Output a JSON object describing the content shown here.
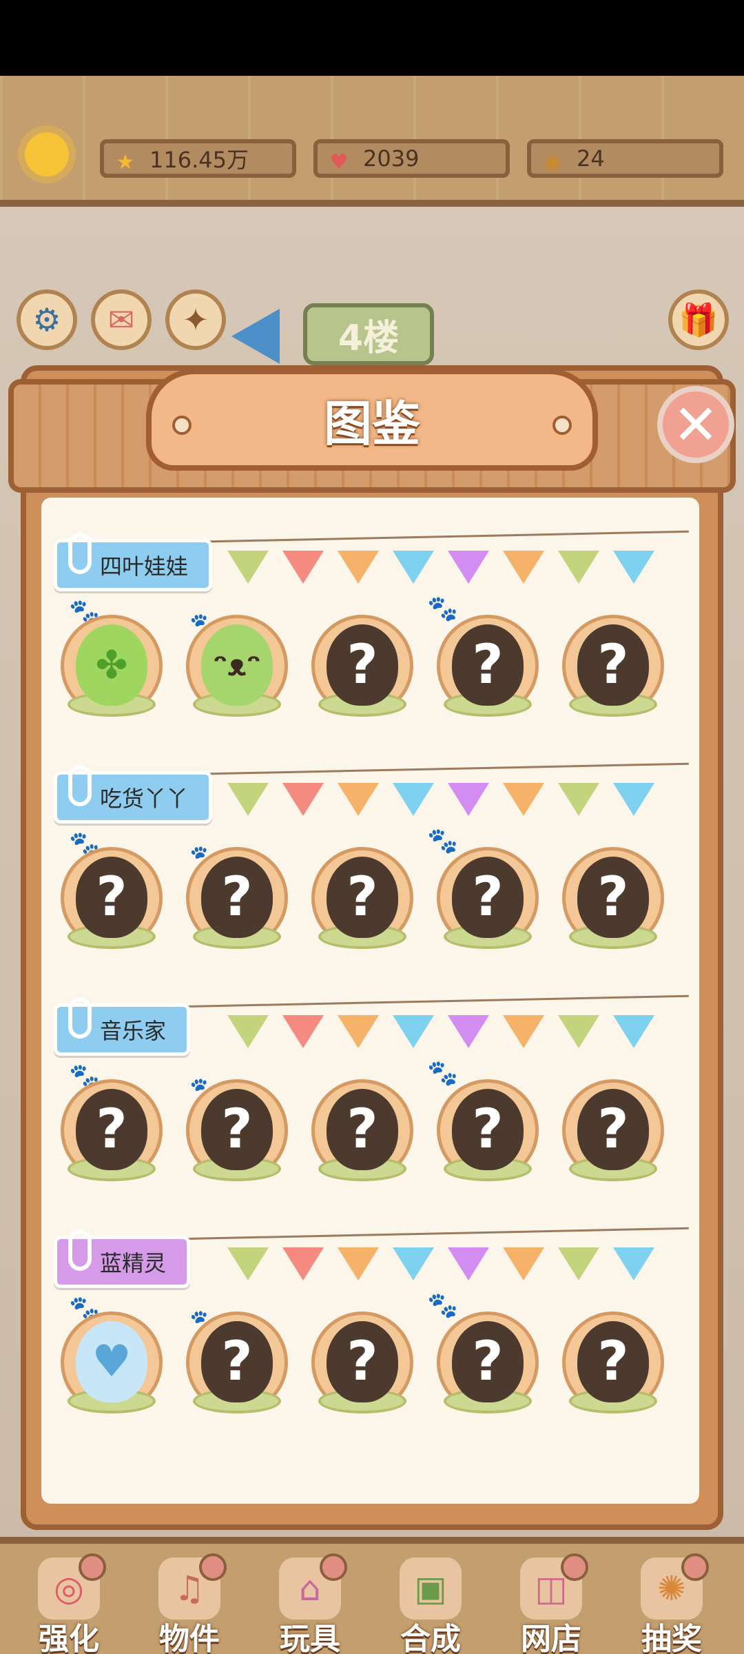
{
  "header": {
    "stars": "116.45万",
    "hearts": "2039",
    "coins": "24"
  },
  "floor_label": "4楼",
  "dialog": {
    "title": "图鉴",
    "close_icon": "close-icon",
    "categories": [
      {
        "name": "四叶娃娃",
        "tag_color": "#8ecdf0",
        "slots": [
          "clover",
          "cracked",
          "unknown",
          "unknown",
          "unknown"
        ]
      },
      {
        "name": "吃货丫丫",
        "tag_color": "#8ecdf0",
        "slots": [
          "unknown",
          "unknown",
          "unknown",
          "unknown",
          "unknown"
        ]
      },
      {
        "name": "音乐家",
        "tag_color": "#8ecdf0",
        "slots": [
          "unknown",
          "unknown",
          "unknown",
          "unknown",
          "unknown"
        ]
      },
      {
        "name": "蓝精灵",
        "tag_color": "#d69be8",
        "slots": [
          "heart",
          "unknown",
          "unknown",
          "unknown",
          "unknown"
        ]
      }
    ],
    "unknown_glyph": "?"
  },
  "bottom_nav": [
    {
      "label": "强化",
      "icon": "spiral-icon"
    },
    {
      "label": "物件",
      "icon": "piano-icon"
    },
    {
      "label": "玩具",
      "icon": "house-toy-icon"
    },
    {
      "label": "合成",
      "icon": "cards-icon"
    },
    {
      "label": "网店",
      "icon": "basket-icon"
    },
    {
      "label": "抽奖",
      "icon": "wheel-icon"
    }
  ]
}
